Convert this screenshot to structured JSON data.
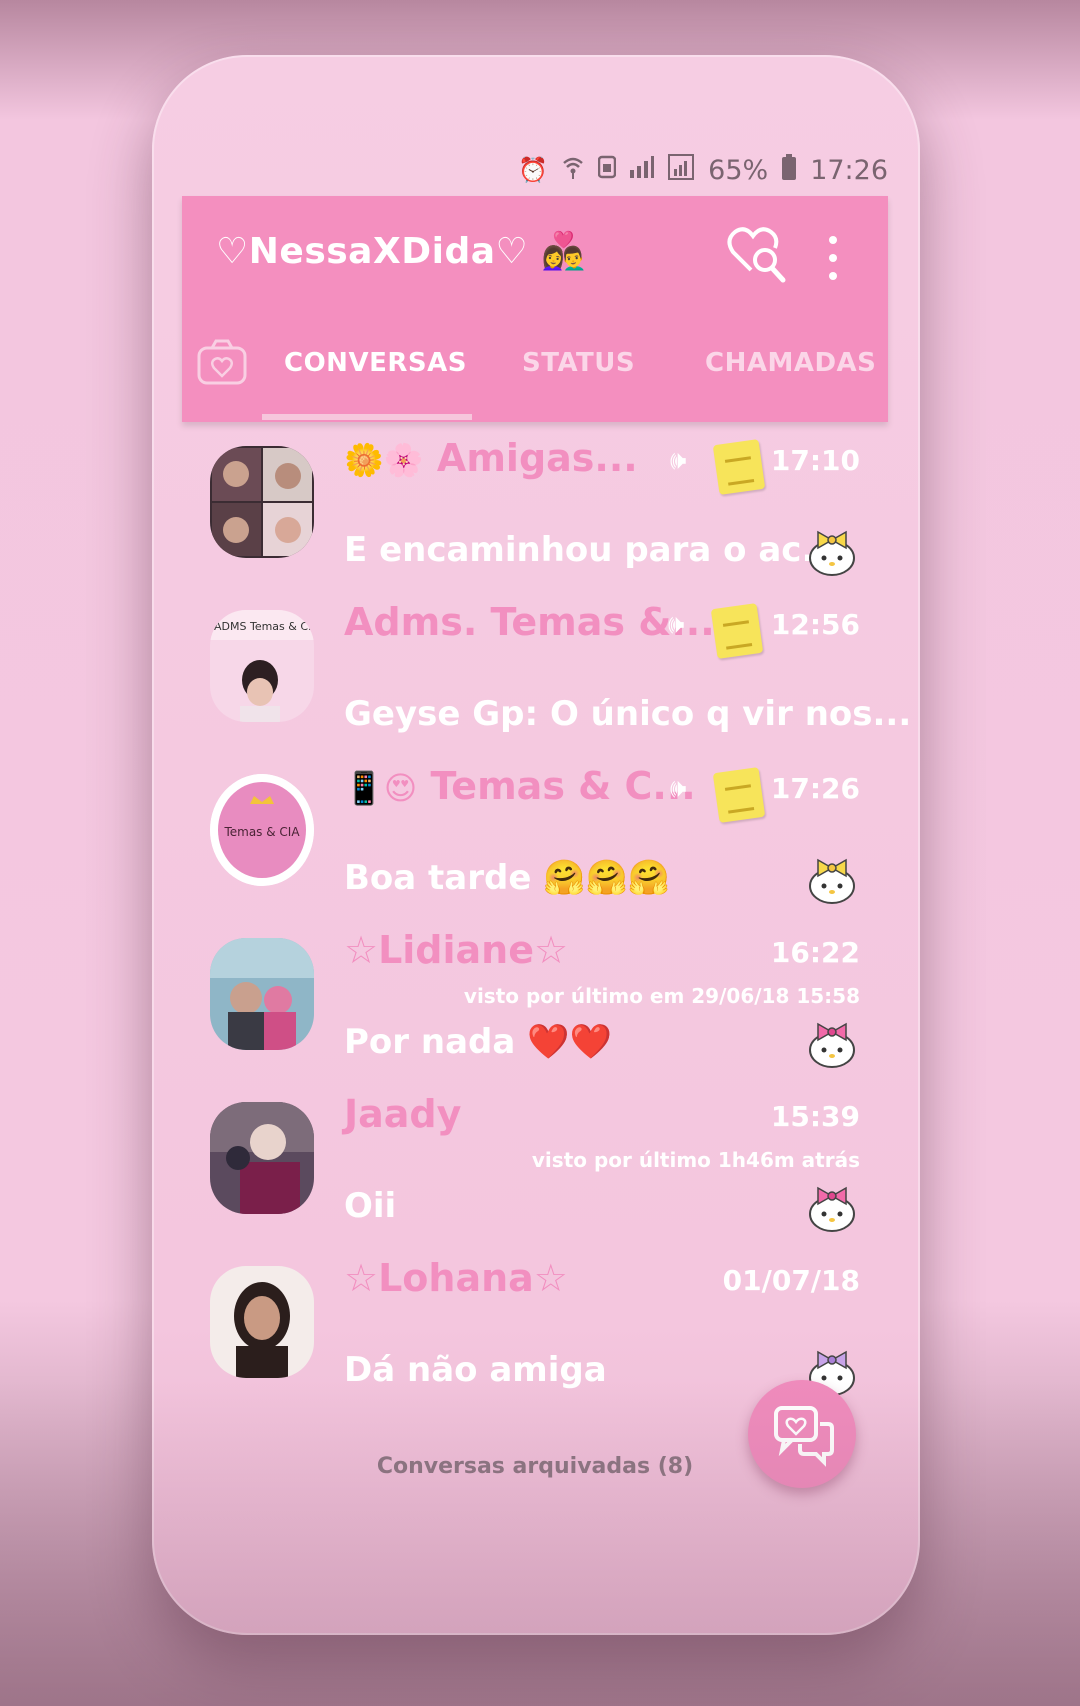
{
  "status_bar": {
    "battery": "65%",
    "time": "17:26"
  },
  "app_bar": {
    "title": "♡NessaXDida♡",
    "title_emoji": "👩‍❤️‍👨"
  },
  "tabs": [
    {
      "label": "CONVERSAS",
      "active": true
    },
    {
      "label": "STATUS",
      "active": false
    },
    {
      "label": "CHAMADAS",
      "active": false
    }
  ],
  "chats": [
    {
      "name": "Amigas...",
      "name_prefix_emoji": "🌼🌸",
      "time": "17:10",
      "message": "E encaminhou para o ac...",
      "badge": "yellow-bow"
    },
    {
      "name": "Adms. Temas &...",
      "time": "12:56",
      "message": "Geyse Gp: O único q vir nos...",
      "avatar_text": "ADMS Temas & C..."
    },
    {
      "name": "Temas & C...",
      "name_prefix_emoji": "📱😍",
      "time": "17:26",
      "message": "Boa tarde",
      "message_emoji": "🤗🤗🤗",
      "avatar_text": "Temas & CIA",
      "badge": "yellow-bow"
    },
    {
      "name": "☆Lidiane☆",
      "time": "16:22",
      "last_seen": "visto por último em 29/06/18 15:58",
      "message": "Por nada",
      "message_emoji": "❤️❤️",
      "badge": "pink-bow"
    },
    {
      "name": "Jaady",
      "time": "15:39",
      "last_seen": "visto por último 1h46m atrás",
      "message": "Oii",
      "badge": "pink-bow"
    },
    {
      "name": "☆Lohana☆",
      "time": "01/07/18",
      "message": "Dá não amiga",
      "badge": "purple-bow"
    }
  ],
  "archived_label": "Conversas arquivadas (8)",
  "colors": {
    "accent": "#f48fbf",
    "background": "#f4c6de",
    "name_color": "#f28fc0"
  }
}
